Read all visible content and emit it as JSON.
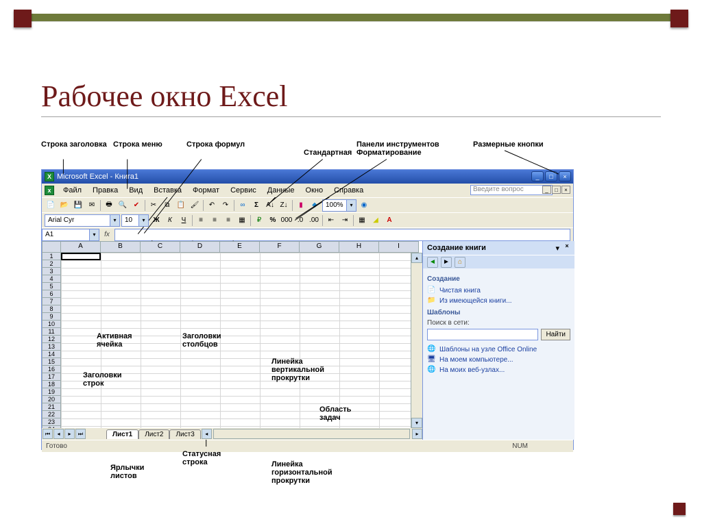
{
  "slide": {
    "title": "Рабочее окно Excel"
  },
  "annotations": {
    "title_bar": "Строка\nзаголовка",
    "menu_bar": "Строка\nменю",
    "formula_bar": "Строка\nформул",
    "toolbar_standard": "Стандартная",
    "tb_label": "Панели инструментов",
    "toolbar_format": "Форматирование",
    "size_buttons": "Размерные кнопки",
    "active_cell": "Активная\nячейка",
    "column_headers": "Заголовки\nстолбцов",
    "row_headers": "Заголовки\nстрок",
    "vscroll": "Линейка\nвертикальной\nпрокрутки",
    "task_pane": "Область\nзадач",
    "status_line": "Статусная\nстрока",
    "sheet_tabs": "Ярлычки\nлистов",
    "hscroll": "Линейка\nгоризонтальной\nпрокрутки"
  },
  "excel": {
    "app_title": "Microsoft Excel - Книга1",
    "ask_placeholder": "Введите вопрос",
    "menu": [
      "Файл",
      "Правка",
      "Вид",
      "Вставка",
      "Формат",
      "Сервис",
      "Данные",
      "Окно",
      "Справка"
    ],
    "font_name": "Arial Cyr",
    "font_size": "10",
    "zoom": "100%",
    "name_box": "A1",
    "columns": [
      "A",
      "B",
      "C",
      "D",
      "E",
      "F",
      "G",
      "H",
      "I"
    ],
    "rows": 24,
    "tabs": [
      "Лист1",
      "Лист2",
      "Лист3"
    ],
    "status": "Готово",
    "num": "NUM"
  },
  "taskpane": {
    "title": "Создание книги",
    "section_create": "Создание",
    "link_blank": "Чистая книга",
    "link_existing": "Из имеющейся книги...",
    "section_templates": "Шаблоны",
    "search_label": "Поиск в сети:",
    "search_btn": "Найти",
    "link_online": "Шаблоны на узле Office Online",
    "link_mypc": "На моем компьютере...",
    "link_myweb": "На моих веб-узлах..."
  }
}
